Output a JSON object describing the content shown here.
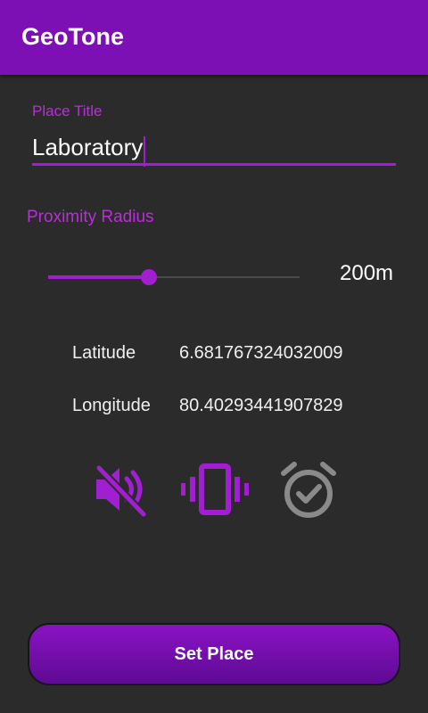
{
  "app": {
    "title": "GeoTone"
  },
  "place": {
    "label": "Place Title",
    "value": "Laboratory"
  },
  "radius": {
    "label": "Proximity Radius",
    "value_text": "200m",
    "slider_fraction": 0.4
  },
  "coords": {
    "latitude_label": "Latitude",
    "latitude_value": "6.681767324032009",
    "longitude_label": "Longitude",
    "longitude_value": "80.40293441907829"
  },
  "modes": [
    {
      "icon": "volume-off-icon",
      "state": "active"
    },
    {
      "icon": "vibrate-icon",
      "state": "active"
    },
    {
      "icon": "alarm-check-icon",
      "state": "inactive"
    }
  ],
  "colors": {
    "accent": "#a11fd0",
    "appbar": "#7d10b5",
    "background": "#2b2b2b",
    "inactive_icon": "#8a8a8a"
  },
  "action": {
    "label": "Set Place"
  }
}
